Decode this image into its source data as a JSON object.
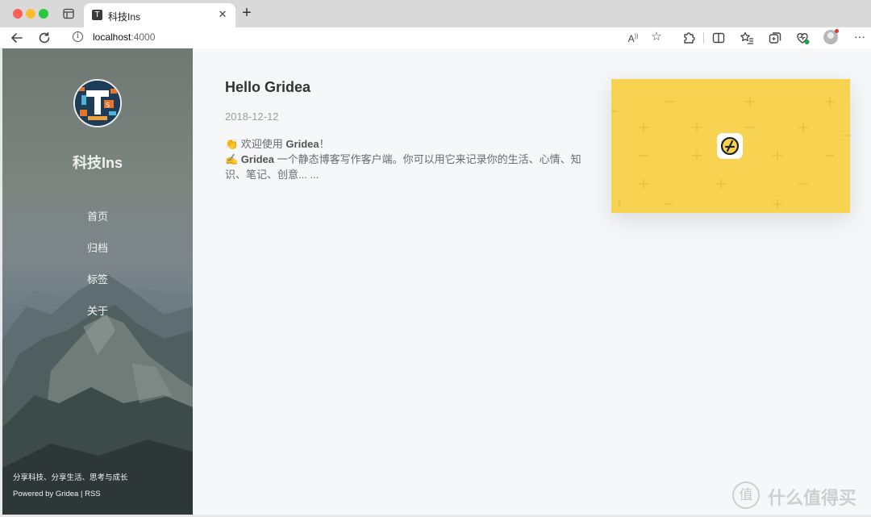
{
  "browser": {
    "tab": {
      "favicon_glyph": "T",
      "title": "科技Ins",
      "close": "✕"
    },
    "new_tab": "+",
    "url": {
      "host": "localhost",
      "port": ":4000"
    }
  },
  "sidebar": {
    "site_title": "科技Ins",
    "nav": [
      {
        "label": "首页"
      },
      {
        "label": "归档"
      },
      {
        "label": "标签"
      },
      {
        "label": "关于"
      }
    ],
    "motto": "分享科技、分享生活、思考与成长",
    "footer": {
      "powered_prefix": "Powered by ",
      "gridea": "Gridea",
      "separator": " | ",
      "rss": "RSS"
    }
  },
  "post": {
    "title": "Hello Gridea",
    "date": "2018-12-12",
    "excerpt_line1_emoji": "👏",
    "excerpt_line1_a": " 欢迎使用 ",
    "excerpt_line1_b": "Gridea",
    "excerpt_line1_c": "！",
    "excerpt_line2_emoji": "✍️",
    "excerpt_line2_a": " Gridea",
    "excerpt_line2_b": " 一个静态博客写作客户端。你可以用它来记录你的生活、心情、知识、笔记、创意... ..."
  },
  "colors": {
    "feature_yellow": "#f8d351",
    "accent_red": "#e0352b"
  },
  "watermark": {
    "text": "什么值得买",
    "icon": "值"
  }
}
